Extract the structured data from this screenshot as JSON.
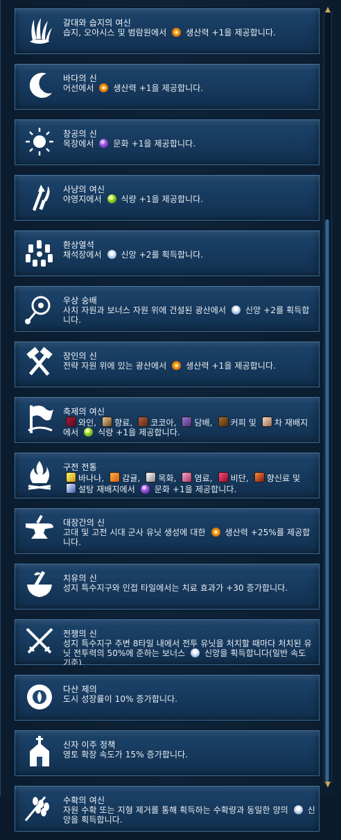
{
  "beliefs": [
    {
      "icon": "marsh-reeds-icon",
      "title": "갈대와 습지의 여신",
      "desc": [
        {
          "t": "text",
          "v": "습지, 오아시스 및 범람원에서 "
        },
        {
          "t": "yield",
          "k": "y-prod",
          "n": "production-icon"
        },
        {
          "t": "text",
          "v": " 생산력 +1을 제공합니다."
        }
      ]
    },
    {
      "icon": "crescent-waves-icon",
      "title": "바다의 신",
      "desc": [
        {
          "t": "text",
          "v": "어선에서 "
        },
        {
          "t": "yield",
          "k": "y-prod",
          "n": "production-icon"
        },
        {
          "t": "text",
          "v": " 생산력 +1을 제공합니다."
        }
      ]
    },
    {
      "icon": "sun-icon",
      "title": "창공의 신",
      "desc": [
        {
          "t": "text",
          "v": "목장에서 "
        },
        {
          "t": "yield",
          "k": "y-culture",
          "n": "culture-icon"
        },
        {
          "t": "text",
          "v": " 문화 +1을 제공합니다."
        }
      ]
    },
    {
      "icon": "spear-knife-icon",
      "title": "사냥의 여신",
      "desc": [
        {
          "t": "text",
          "v": "야영지에서 "
        },
        {
          "t": "yield",
          "k": "y-food",
          "n": "food-icon"
        },
        {
          "t": "text",
          "v": " 식량 +1을 제공합니다."
        }
      ]
    },
    {
      "icon": "stone-circle-icon",
      "title": "환상열석",
      "desc": [
        {
          "t": "text",
          "v": "채석장에서 "
        },
        {
          "t": "yield",
          "k": "y-faith",
          "n": "faith-icon"
        },
        {
          "t": "text",
          "v": " 신앙 +2를 획득합니다."
        }
      ]
    },
    {
      "icon": "prayer-beads-icon",
      "title": "우상 숭배",
      "desc": [
        {
          "t": "text",
          "v": "사치 자원과 보너스 자원 위에 건설된 광산에서 "
        },
        {
          "t": "yield",
          "k": "y-faith",
          "n": "faith-icon"
        },
        {
          "t": "text",
          "v": " 신앙 +2를 획득합니다."
        }
      ]
    },
    {
      "icon": "crossed-hammers-icon",
      "title": "장인의 신",
      "desc": [
        {
          "t": "text",
          "v": "전략 자원 위에 있는 광산에서 "
        },
        {
          "t": "yield",
          "k": "y-prod",
          "n": "production-icon"
        },
        {
          "t": "text",
          "v": " 생산력 +1을 제공합니다."
        }
      ]
    },
    {
      "icon": "festival-flag-icon",
      "title": "축제의 여신",
      "desc": [
        {
          "t": "res",
          "k": "r-wine",
          "n": "wine-icon"
        },
        {
          "t": "text",
          "v": "와인, "
        },
        {
          "t": "res",
          "k": "r-incense",
          "n": "incense-icon"
        },
        {
          "t": "text",
          "v": "향료, "
        },
        {
          "t": "res",
          "k": "r-cocoa",
          "n": "cocoa-icon"
        },
        {
          "t": "text",
          "v": "코코아, "
        },
        {
          "t": "res",
          "k": "r-tobacco",
          "n": "tobacco-icon"
        },
        {
          "t": "text",
          "v": "담배, "
        },
        {
          "t": "res",
          "k": "r-coffee",
          "n": "coffee-icon"
        },
        {
          "t": "text",
          "v": "커피 및 "
        },
        {
          "t": "res",
          "k": "r-tea",
          "n": "tea-icon"
        },
        {
          "t": "text",
          "v": "차 재배지에서 "
        },
        {
          "t": "yield",
          "k": "y-food",
          "n": "food-icon"
        },
        {
          "t": "text",
          "v": " 식량 +1을 제공합니다."
        }
      ]
    },
    {
      "icon": "campfire-icon",
      "title": "구전 전통",
      "desc": [
        {
          "t": "res",
          "k": "r-banana",
          "n": "banana-icon"
        },
        {
          "t": "text",
          "v": "바나나, "
        },
        {
          "t": "res",
          "k": "r-citrus",
          "n": "citrus-icon"
        },
        {
          "t": "text",
          "v": "감귤, "
        },
        {
          "t": "res",
          "k": "r-cotton",
          "n": "cotton-icon"
        },
        {
          "t": "text",
          "v": "목화, "
        },
        {
          "t": "res",
          "k": "r-dye",
          "n": "dye-icon"
        },
        {
          "t": "text",
          "v": "염료, "
        },
        {
          "t": "res",
          "k": "r-silk",
          "n": "silk-icon"
        },
        {
          "t": "text",
          "v": "비단, "
        },
        {
          "t": "res",
          "k": "r-spice",
          "n": "spice-icon"
        },
        {
          "t": "text",
          "v": "향신료 및 "
        },
        {
          "t": "res",
          "k": "r-sugar",
          "n": "sugar-icon"
        },
        {
          "t": "text",
          "v": "설탕 재배지에서 "
        },
        {
          "t": "yield",
          "k": "y-culture",
          "n": "culture-icon"
        },
        {
          "t": "text",
          "v": " 문화 +1을 제공합니다."
        }
      ]
    },
    {
      "icon": "anvil-icon",
      "title": "대장간의 신",
      "desc": [
        {
          "t": "text",
          "v": "고대 및 고전 시대 군사 유닛 생성에 대한 "
        },
        {
          "t": "yield",
          "k": "y-prod",
          "n": "production-icon"
        },
        {
          "t": "text",
          "v": " 생산력 +25%를 제공합니다."
        }
      ]
    },
    {
      "icon": "mortar-pestle-icon",
      "title": "치유의 신",
      "desc": [
        {
          "t": "text",
          "v": "성지 특수지구와 인접 타일에서는 치료 효과가 +30 증가합니다."
        }
      ]
    },
    {
      "icon": "crossed-swords-icon",
      "title": "전쟁의 신",
      "desc": [
        {
          "t": "text",
          "v": "성지 특수지구 주변 8타일 내에서 전투 유닛을 처치할 때마다 처치된 유닛 전투력의 50%에 준하는 보너스 "
        },
        {
          "t": "yield",
          "k": "y-faith",
          "n": "faith-icon"
        },
        {
          "t": "text",
          "v": " 신앙을 획득합니다(일반 속도 기준)."
        }
      ]
    },
    {
      "icon": "lotus-flower-icon",
      "title": "다산 제의",
      "desc": [
        {
          "t": "text",
          "v": "도시 성장률이 10% 증가합니다."
        }
      ]
    },
    {
      "icon": "chapel-icon",
      "title": "신자 이주 정책",
      "desc": [
        {
          "t": "text",
          "v": "영토 확장 속도가 15% 증가합니다."
        }
      ]
    },
    {
      "icon": "grain-harvest-icon",
      "title": "수확의 여신",
      "desc": [
        {
          "t": "text",
          "v": "자원 수확 또는 지형 제거를 통해 획득하는 수확량과 동일한 양의 "
        },
        {
          "t": "yield",
          "k": "y-faith",
          "n": "faith-icon"
        },
        {
          "t": "text",
          "v": " 신앙을 획득합니다."
        }
      ]
    }
  ],
  "scroll": {
    "position": 0.27,
    "up_arrow": "scroll-up-arrow-icon",
    "down_arrow": "scroll-down-arrow-icon"
  },
  "colors": {
    "panel": "#0e2338",
    "card": "#1f4770",
    "text": "#f3f6f9",
    "accent": "#c9a75a"
  }
}
